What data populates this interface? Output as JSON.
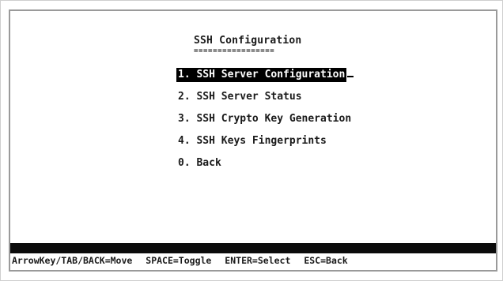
{
  "menu": {
    "title": "SSH Configuration",
    "title_underline": "=================",
    "items": [
      {
        "label": "1. SSH Server Configuration",
        "selected": true
      },
      {
        "label": "2. SSH Server Status",
        "selected": false
      },
      {
        "label": "3. SSH Crypto Key Generation",
        "selected": false
      },
      {
        "label": "4. SSH Keys Fingerprints",
        "selected": false
      },
      {
        "label": "0. Back",
        "selected": false
      }
    ]
  },
  "hints": {
    "move": "ArrowKey/TAB/BACK=Move",
    "toggle": "SPACE=Toggle",
    "select": "ENTER=Select",
    "back": "ESC=Back"
  },
  "colors": {
    "selection_bg": "#000000",
    "selection_fg": "#ffffff",
    "text": "#1a1a1a"
  }
}
